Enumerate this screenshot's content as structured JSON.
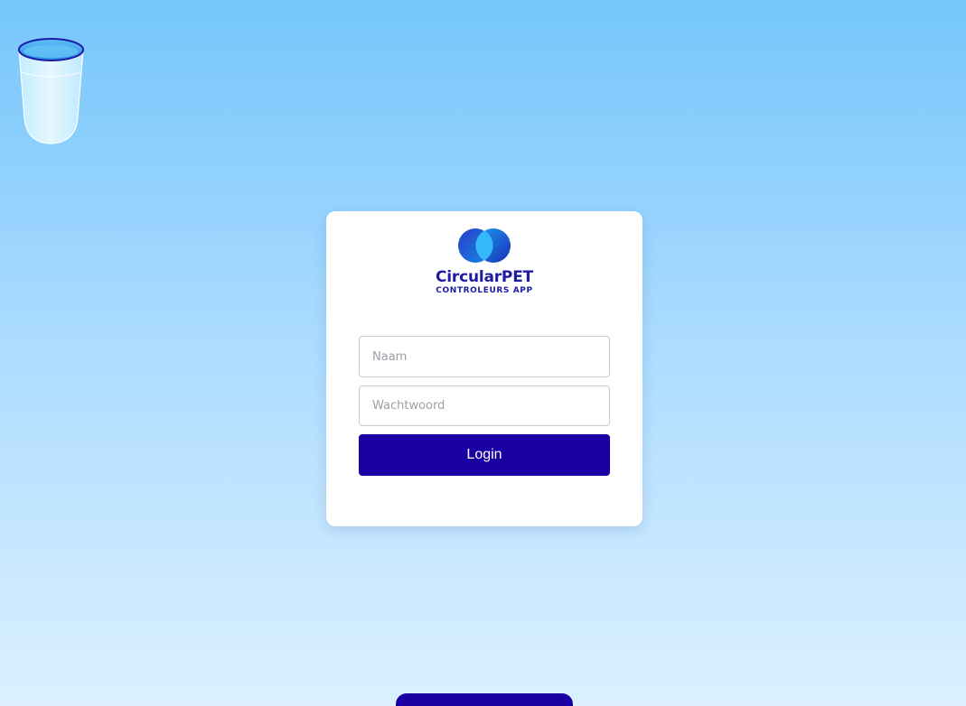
{
  "decoration": {
    "cup_icon": "water-cup-icon"
  },
  "logo": {
    "mark_icon": "circularpet-logo-icon",
    "title": "CircularPET",
    "subtitle": "CONTROLEURS APP"
  },
  "login_form": {
    "name_placeholder": "Naam",
    "password_placeholder": "Wachtwoord",
    "login_label": "Login"
  },
  "colors": {
    "primary": "#1a00a3",
    "brand_text": "#1f1aa3",
    "background_top": "#75c6fb",
    "background_bottom": "#dcf0ff",
    "card": "#ffffff"
  }
}
